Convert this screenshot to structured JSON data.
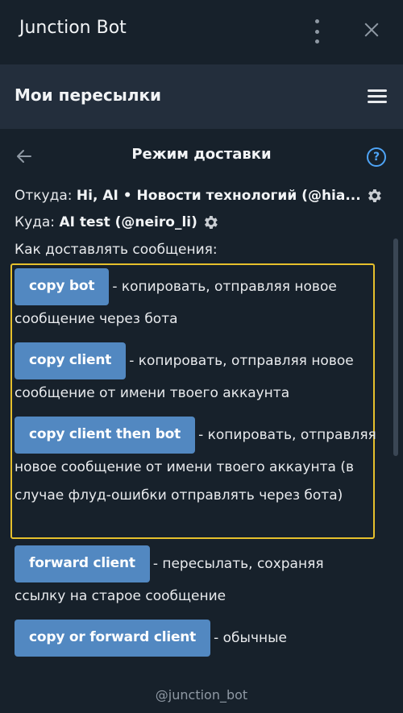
{
  "app": {
    "title": "Junction Bot"
  },
  "header": {
    "title": "Мои пересылки"
  },
  "page": {
    "title": "Режим доставки"
  },
  "from": {
    "label": "Откуда:",
    "value": "Hi, AI • Новости технологий (@hia..."
  },
  "to": {
    "label": "Куда:",
    "value": "AI test (@neiro_li)"
  },
  "how_label": "Как доставлять сообщения:",
  "modes": [
    {
      "button": "copy bot",
      "desc": "- копировать, отправляя новое сообщение через бота"
    },
    {
      "button": "copy client",
      "desc": "- копировать, отправляя новое сообщение от имени твоего аккаунта"
    },
    {
      "button": "copy client then bot",
      "desc": "- копировать, отправляя новое сообщение от имени твоего аккаунта (в случае флуд-ошибки отправлять через бота)"
    },
    {
      "button": "forward client",
      "desc": "- пересылать, сохраняя ссылку на старое сообщение"
    },
    {
      "button": "copy or forward client",
      "desc": "- обычные"
    }
  ],
  "footer": "@junction_bot",
  "icons": {
    "menu": "kebab-menu-icon",
    "close": "close-icon",
    "burger": "hamburger-icon",
    "back": "back-arrow-icon",
    "help": "help-icon",
    "settings": "gear-icon"
  },
  "colors": {
    "background": "#17212b",
    "header": "#232e3c",
    "button": "#5288c1",
    "highlight": "#e6c02c",
    "link": "#4ea4f6"
  }
}
